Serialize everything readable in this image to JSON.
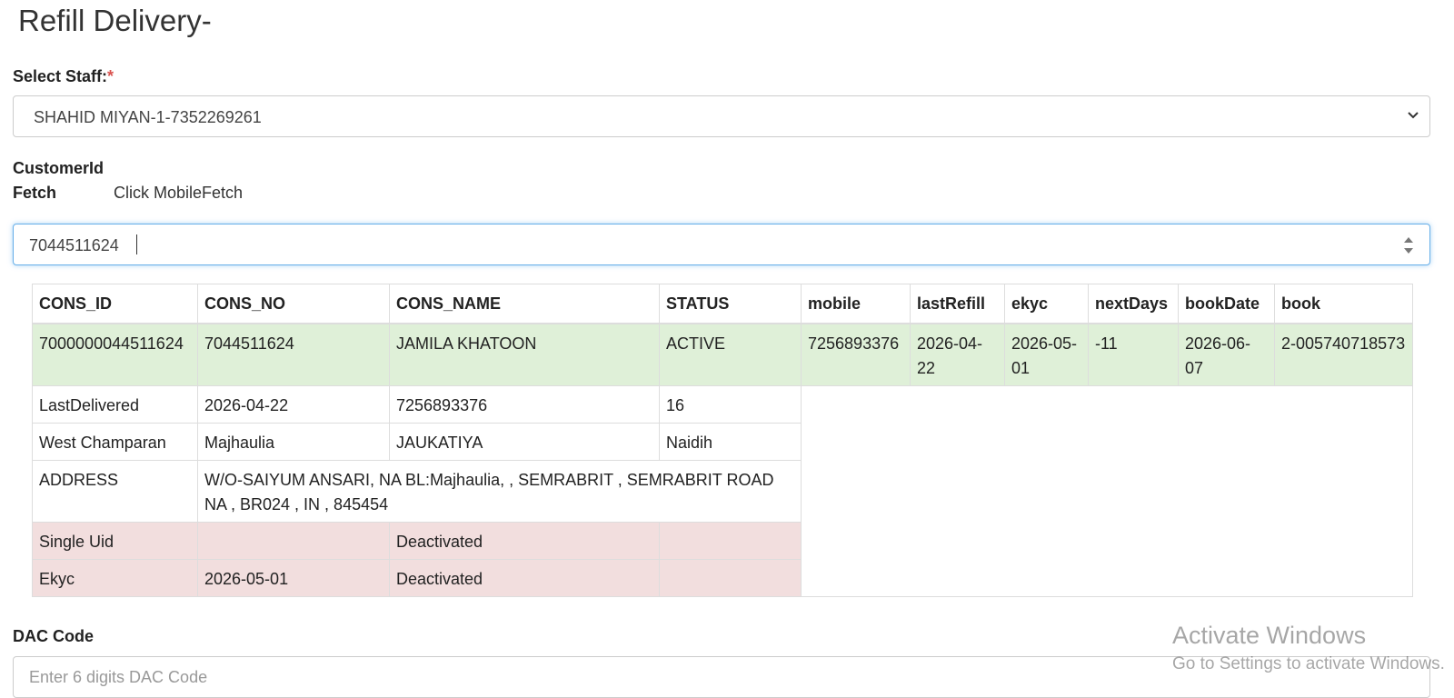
{
  "page": {
    "title": "Refill Delivery-",
    "staff_label": "Select Staff:",
    "required_mark": "*",
    "customer_label": "CustomerId",
    "fetch_label": "Fetch",
    "click_mobile_fetch": "Click MobileFetch"
  },
  "staff_select": {
    "value": "SHAHID MIYAN-1-7352269261"
  },
  "mobile_input": {
    "value": "7044511624"
  },
  "table": {
    "headers": [
      "CONS_ID",
      "CONS_NO",
      "CONS_NAME",
      "STATUS",
      "mobile",
      "lastRefill",
      "ekyc",
      "nextDays",
      "bookDate",
      "book"
    ],
    "main_row": [
      "7000000044511624",
      "7044511624",
      "JAMILA KHATOON",
      "ACTIVE",
      "7256893376",
      "2026-04-22",
      "2026-05-01",
      "-11",
      "2026-06-07",
      "2-005740718573"
    ],
    "last_delivered_row": [
      "LastDelivered",
      "2026-04-22",
      "7256893376",
      "16"
    ],
    "location_row": [
      "West Champaran",
      "Majhaulia",
      "JAUKATIYA",
      "Naidih"
    ],
    "address_row": [
      "ADDRESS",
      "W/O-SAIYUM ANSARI, NA BL:Majhaulia, , SEMRABRIT , SEMRABRIT ROAD NA , BR024 , IN , 845454"
    ],
    "single_uid_row": [
      "Single Uid",
      "",
      "Deactivated",
      ""
    ],
    "ekyc_row": [
      "Ekyc",
      "2026-05-01",
      "Deactivated",
      ""
    ]
  },
  "dac": {
    "label": "DAC Code",
    "placeholder": "Enter 6 digits DAC Code"
  },
  "watermark": {
    "line1": "Activate Windows",
    "line2": "Go to Settings to activate Windows."
  },
  "colors": {
    "success_row": "#dff0d8",
    "danger_row": "#f2dede",
    "focus_border": "#66afe9",
    "required": "#d9534f"
  }
}
